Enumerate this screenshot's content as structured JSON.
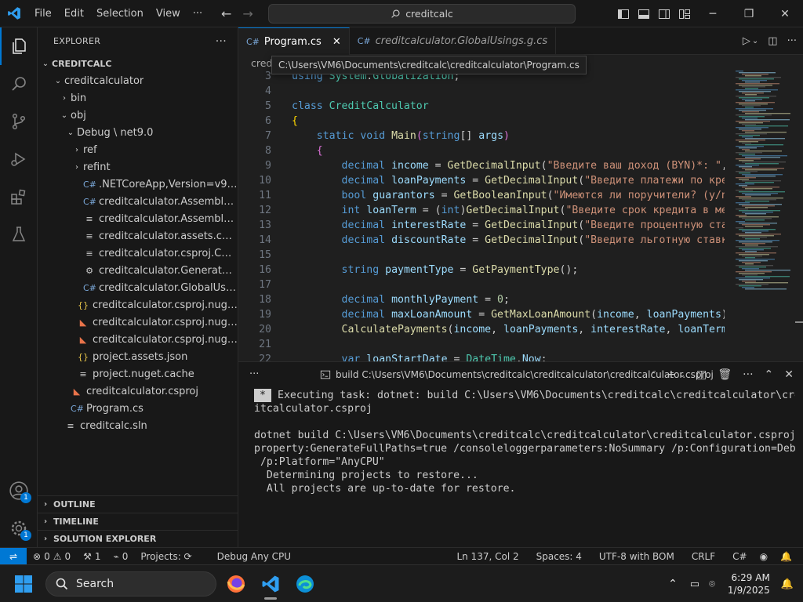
{
  "menu": {
    "file": "File",
    "edit": "Edit",
    "selection": "Selection",
    "view": "View",
    "more": "···"
  },
  "command_center": {
    "text": "creditcalc"
  },
  "explorer": {
    "title": "EXPLORER",
    "root": "CREDITCALC",
    "items": [
      {
        "label": "creditcalculator",
        "indent": 1,
        "chev": "⌄",
        "icon": ""
      },
      {
        "label": "bin",
        "indent": 2,
        "chev": "›",
        "icon": ""
      },
      {
        "label": "obj",
        "indent": 2,
        "chev": "⌄",
        "icon": ""
      },
      {
        "label": "Debug \\ net9.0",
        "indent": 3,
        "chev": "⌄",
        "icon": ""
      },
      {
        "label": "ref",
        "indent": 4,
        "chev": "›",
        "icon": ""
      },
      {
        "label": "refint",
        "indent": 4,
        "chev": "›",
        "icon": ""
      },
      {
        "label": ".NETCoreApp,Version=v9.0.Asse...",
        "indent": 4,
        "chev": "",
        "icon": "cs"
      },
      {
        "label": "creditcalculator.AssemblyInfo.cs",
        "indent": 4,
        "chev": "",
        "icon": "cs"
      },
      {
        "label": "creditcalculator.AssemblyInfoInp...",
        "indent": 4,
        "chev": "",
        "icon": "lines"
      },
      {
        "label": "creditcalculator.assets.cache",
        "indent": 4,
        "chev": "",
        "icon": "lines"
      },
      {
        "label": "creditcalculator.csproj.CoreCom...",
        "indent": 4,
        "chev": "",
        "icon": "lines"
      },
      {
        "label": "creditcalculator.GeneratedMSBui...",
        "indent": 4,
        "chev": "",
        "icon": "gear"
      },
      {
        "label": "creditcalculator.GlobalUsings.g.cs",
        "indent": 4,
        "chev": "",
        "icon": "cs"
      },
      {
        "label": "creditcalculator.csproj.nuget.dgsp...",
        "indent": 3,
        "chev": "",
        "icon": "json"
      },
      {
        "label": "creditcalculator.csproj.nuget.g.pro...",
        "indent": 3,
        "chev": "",
        "icon": "rss"
      },
      {
        "label": "creditcalculator.csproj.nuget.g.tar...",
        "indent": 3,
        "chev": "",
        "icon": "rss"
      },
      {
        "label": "project.assets.json",
        "indent": 3,
        "chev": "",
        "icon": "json"
      },
      {
        "label": "project.nuget.cache",
        "indent": 3,
        "chev": "",
        "icon": "lines"
      },
      {
        "label": "creditcalculator.csproj",
        "indent": 2,
        "chev": "",
        "icon": "rss"
      },
      {
        "label": "Program.cs",
        "indent": 2,
        "chev": "",
        "icon": "cs"
      },
      {
        "label": "creditcalc.sln",
        "indent": 1,
        "chev": "",
        "icon": "lines"
      }
    ],
    "sections": {
      "outline": "OUTLINE",
      "timeline": "TIMELINE",
      "solution": "SOLUTION EXPLORER"
    }
  },
  "tabs": {
    "active": "Program.cs",
    "inactive": "creditcalculator.GlobalUsings.g.cs"
  },
  "breadcrumb": "creditc",
  "tooltip": "C:\\Users\\VM6\\Documents\\creditcalc\\creditcalculator\\Program.cs",
  "code_lines": [
    {
      "n": "3",
      "html": "<span class=\"kw\">using</span> <span class=\"ty\">System</span>.<span class=\"ty\">Globalization</span>;"
    },
    {
      "n": "4",
      "html": ""
    },
    {
      "n": "5",
      "html": "<span class=\"kw\">class</span> <span class=\"ty\">CreditCalculator</span>"
    },
    {
      "n": "6",
      "html": "<span class=\"br\">{</span>"
    },
    {
      "n": "7",
      "html": "    <span class=\"kw\">static</span> <span class=\"kw\">void</span> <span class=\"fn\">Main</span><span class=\"br2\">(</span><span class=\"kw\">string</span>[] <span class=\"vr\">args</span><span class=\"br2\">)</span>"
    },
    {
      "n": "8",
      "html": "    <span class=\"br2\">{</span>"
    },
    {
      "n": "9",
      "html": "        <span class=\"kw\">decimal</span> <span class=\"vr\">income</span> = <span class=\"fn\">GetDecimalInput</span>(<span class=\"st\">\"Введите ваш доход (BYN)*: \"</span>, <span class=\"kw\">t</span>"
    },
    {
      "n": "10",
      "html": "        <span class=\"kw\">decimal</span> <span class=\"vr\">loanPayments</span> = <span class=\"fn\">GetDecimalInput</span>(<span class=\"st\">\"Введите платежи по креди</span>"
    },
    {
      "n": "11",
      "html": "        <span class=\"kw\">bool</span> <span class=\"vr\">guarantors</span> = <span class=\"fn\">GetBooleanInput</span>(<span class=\"st\">\"Имеются ли поручители? (y/n):</span>"
    },
    {
      "n": "12",
      "html": "        <span class=\"kw\">int</span> <span class=\"vr\">loanTerm</span> = (<span class=\"kw\">int</span>)<span class=\"fn\">GetDecimalInput</span>(<span class=\"st\">\"Введите срок кредита в меся</span>"
    },
    {
      "n": "13",
      "html": "        <span class=\"kw\">decimal</span> <span class=\"vr\">interestRate</span> = <span class=\"fn\">GetDecimalInput</span>(<span class=\"st\">\"Введите процентную ставку</span>"
    },
    {
      "n": "14",
      "html": "        <span class=\"kw\">decimal</span> <span class=\"vr\">discountRate</span> = <span class=\"fn\">GetDecimalInput</span>(<span class=\"st\">\"Введите льготную ставку </span>"
    },
    {
      "n": "15",
      "html": ""
    },
    {
      "n": "16",
      "html": "        <span class=\"kw\">string</span> <span class=\"vr\">paymentType</span> = <span class=\"fn\">GetPaymentType</span>();"
    },
    {
      "n": "17",
      "html": ""
    },
    {
      "n": "18",
      "html": "        <span class=\"kw\">decimal</span> <span class=\"vr\">monthlyPayment</span> = <span class=\"nm\">0</span>;"
    },
    {
      "n": "19",
      "html": "        <span class=\"kw\">decimal</span> <span class=\"vr\">maxLoanAmount</span> = <span class=\"fn\">GetMaxLoanAmount</span>(<span class=\"vr\">income</span>, <span class=\"vr\">loanPayments</span>);"
    },
    {
      "n": "20",
      "html": "        <span class=\"fn\">CalculatePayments</span>(<span class=\"vr\">income</span>, <span class=\"vr\">loanPayments</span>, <span class=\"vr\">interestRate</span>, <span class=\"vr\">loanTerm</span>, <span class=\"vr\">p</span>"
    },
    {
      "n": "21",
      "html": ""
    },
    {
      "n": "22",
      "html": "        <span class=\"kw\">var</span> <span class=\"vr\">loanStartDate</span> = <span class=\"ty\">DateTime</span>.<span class=\"vr\">Now</span>;"
    }
  ],
  "panel": {
    "title": "build C:\\Users\\VM6\\Documents\\creditcalc\\creditcalculator\\creditcalculator.csproj",
    "terminal": [
      "Executing task: dotnet: build C:\\Users\\VM6\\Documents\\creditcalc\\creditcalculator\\cred",
      "itcalculator.csproj",
      "",
      "dotnet build C:\\Users\\VM6\\Documents\\creditcalc\\creditcalculator\\creditcalculator.csproj /",
      "property:GenerateFullPaths=true /consoleloggerparameters:NoSummary /p:Configuration=Debug",
      " /p:Platform=\"AnyCPU\"",
      "  Determining projects to restore...",
      "  All projects are up-to-date for restore."
    ]
  },
  "status": {
    "errors": "0",
    "warnings": "0",
    "tools": "1",
    "ports": "0",
    "projects": "Projects: ⟳",
    "config": "Debug Any CPU",
    "position": "Ln 137, Col 2",
    "spaces": "Spaces: 4",
    "encoding": "UTF-8 with BOM",
    "eol": "CRLF",
    "language": "C#"
  },
  "accounts_badge": "1",
  "settings_badge": "1",
  "taskbar": {
    "search": "Search",
    "time": "6:29 AM",
    "date": "1/9/2025"
  }
}
